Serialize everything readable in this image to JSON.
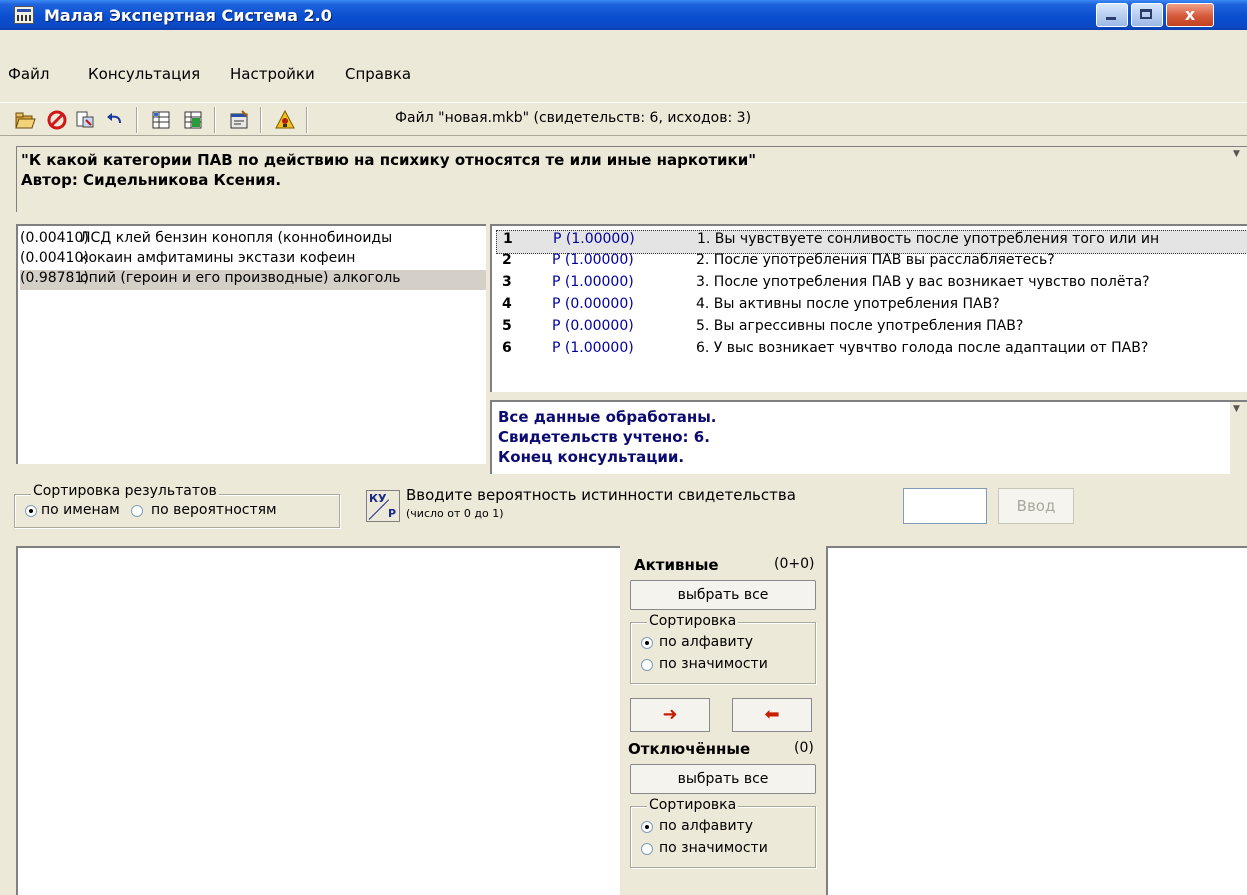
{
  "window": {
    "title": "Малая Экспертная Система 2.0",
    "close_glyph": "x"
  },
  "menu": [
    "Файл",
    "Консультация",
    "Настройки",
    "Справка"
  ],
  "toolbar": {
    "status": "Файл \"новая.mkb\" (свидетельств: 6, исходов: 3)"
  },
  "header": {
    "line1": "\"К какой категории ПАВ по действию на психику относятся те или иные наркотики\"",
    "line2": "Автор: Сидельникова Ксения."
  },
  "outcomes": [
    {
      "prob": "(0.00410)",
      "text": "ЛСД клей бензин конопля (коннобиноиды",
      "selected": false
    },
    {
      "prob": "(0.00410)",
      "text": "кокаин амфитамины экстази кофеин",
      "selected": false
    },
    {
      "prob": "(0.98781)",
      "text": "опий (героин и его производные) алкоголь",
      "selected": true
    }
  ],
  "evidence": [
    {
      "num": "1",
      "prob": "P (1.00000)",
      "text": "1. Вы чувствуете сонливость после употребления того или ин"
    },
    {
      "num": "2",
      "prob": "P (1.00000)",
      "text": "2. После употребления ПАВ вы расслабляетесь?"
    },
    {
      "num": "3",
      "prob": "P (1.00000)",
      "text": "3. После употребления ПАВ у вас возникает чувство полёта?"
    },
    {
      "num": "4",
      "prob": "P (0.00000)",
      "text": "4. Вы активны после употребления ПАВ?"
    },
    {
      "num": "5",
      "prob": "P (0.00000)",
      "text": "5. Вы агрессивны после употребления ПАВ?"
    },
    {
      "num": "6",
      "prob": "P (1.00000)",
      "text": "6. У выс возникает чувчтво голода после адаптации от ПАВ?"
    }
  ],
  "result": {
    "line1": "Все данные обработаны.",
    "line2": "Свидетельств учтено: 6.",
    "line3": "Конец консультации."
  },
  "sort_results": {
    "title": "Сортировка результатов",
    "by_name": "по именам",
    "by_prob": "по вероятностям",
    "selected": "by_name"
  },
  "input": {
    "kyp_top": "КУ",
    "kyp_bottom": "Р",
    "prompt": "Вводите вероятность истинности свидетельства",
    "range": "(число от 0 до 1)",
    "value": "",
    "enter_label": "Ввод"
  },
  "active": {
    "title": "Активные",
    "count": "(0+0)",
    "select_all": "выбрать все",
    "sort_title": "Сортировка",
    "alpha": "по алфавиту",
    "significance": "по значимости",
    "selected": "alpha"
  },
  "arrows": {
    "right": "➜",
    "left": "⬅"
  },
  "disabled": {
    "title": "Отключённые",
    "count": "(0)",
    "select_all": "выбрать все",
    "sort_title": "Сортировка",
    "alpha": "по алфавиту",
    "significance": "по значимости",
    "selected": "alpha"
  },
  "colors": {
    "titlebar": "#0a4fd0",
    "face": "#ece9d8",
    "evidence_prob": "#0000a0",
    "result_text": "#0a0a70",
    "arrow": "#c81e00"
  }
}
